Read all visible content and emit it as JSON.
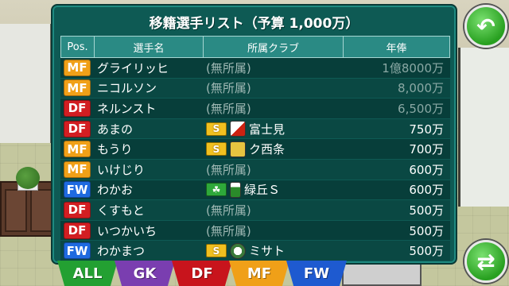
{
  "title": "移籍選手リスト（予算 1,000万）",
  "columns": {
    "pos": "Pos.",
    "name": "選手名",
    "club": "所属クラブ",
    "salary": "年俸"
  },
  "players": [
    {
      "pos": "MF",
      "name": "グライリッヒ",
      "club": "(無所属)",
      "salary": "1億8000万",
      "club_icon": "none",
      "dim": true
    },
    {
      "pos": "MF",
      "name": "ニコルソン",
      "club": "(無所属)",
      "salary": "8,000万",
      "club_icon": "none",
      "dim": true
    },
    {
      "pos": "DF",
      "name": "ネルンスト",
      "club": "(無所属)",
      "salary": "6,500万",
      "club_icon": "none",
      "dim": true
    },
    {
      "pos": "DF",
      "name": "あまの",
      "club": "富士見",
      "salary": "750万",
      "club_icon": "s-league-icon",
      "crest": "fuji"
    },
    {
      "pos": "MF",
      "name": "もうり",
      "club": "ク西条",
      "salary": "700万",
      "club_icon": "s-league-icon",
      "crest": "nishi"
    },
    {
      "pos": "MF",
      "name": "いけじり",
      "club": "(無所属)",
      "salary": "600万",
      "club_icon": "none"
    },
    {
      "pos": "FW",
      "name": "わかお",
      "club": "緑丘Ｓ",
      "salary": "600万",
      "club_icon": "leaf-icon",
      "crest": "midori"
    },
    {
      "pos": "DF",
      "name": "くすもと",
      "club": "(無所属)",
      "salary": "500万",
      "club_icon": "none"
    },
    {
      "pos": "DF",
      "name": "いつかいち",
      "club": "(無所属)",
      "salary": "500万",
      "club_icon": "none"
    },
    {
      "pos": "FW",
      "name": "わかまつ",
      "club": "ミサト",
      "salary": "500万",
      "club_icon": "s-league-icon",
      "crest": "misato"
    }
  ],
  "tabs": [
    "ALL",
    "GK",
    "DF",
    "MF",
    "FW"
  ],
  "s_icon_label": "S",
  "colors": {
    "MF": "#f0a018",
    "DF": "#d21e22",
    "FW": "#1e6ae0",
    "panel": "#0e5a54"
  }
}
